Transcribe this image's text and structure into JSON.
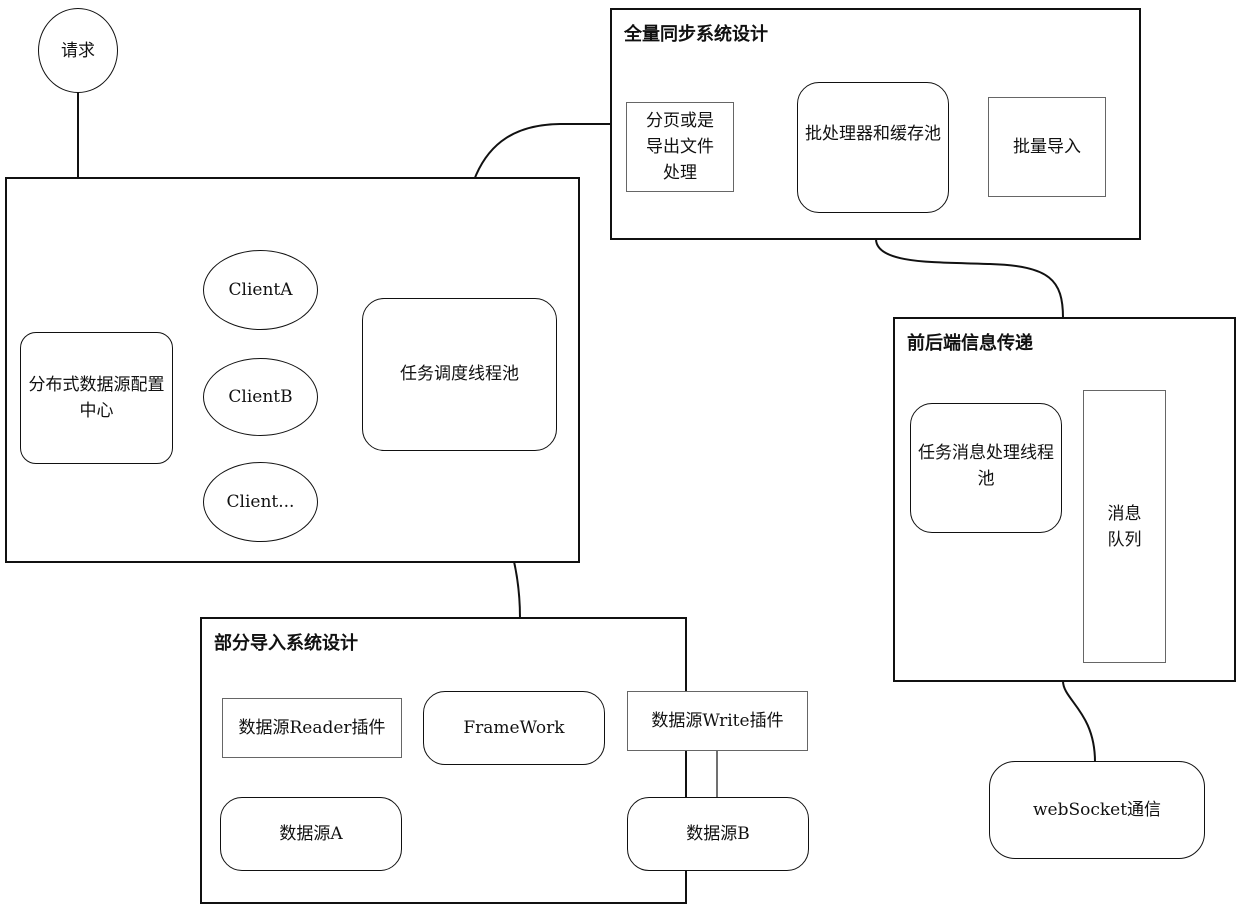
{
  "diagram": {
    "request": "请求",
    "main": {
      "config_center": "分布式数据源配置中心",
      "clients": [
        "ClientA",
        "ClientB",
        "Client..."
      ],
      "scheduler": "任务调度线程池"
    },
    "full_sync": {
      "title": "全量同步系统设计",
      "paging": "分页或是导出文件处理",
      "batch": "批处理器和缓存池",
      "bulk_import": "批量导入"
    },
    "frontend": {
      "title": "前后端信息传递",
      "msg_pool": "任务消息处理线程池",
      "queue": "消息队列"
    },
    "websocket": "webSocket通信",
    "partial": {
      "title": "部分导入系统设计",
      "reader": "数据源Reader插件",
      "framework": "FrameWork",
      "writer": "数据源Write插件",
      "source_a": "数据源A",
      "source_b": "数据源B"
    }
  }
}
